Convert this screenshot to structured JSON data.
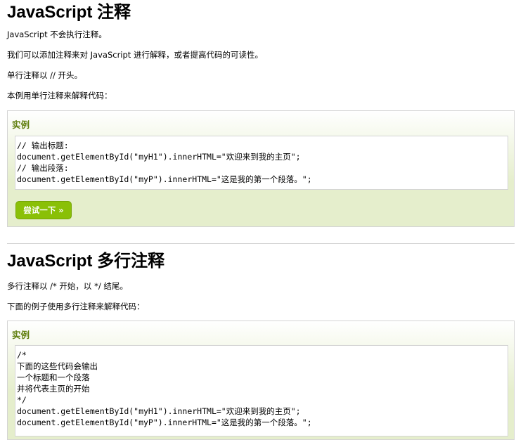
{
  "section1": {
    "heading": "JavaScript 注释",
    "paragraphs": [
      "JavaScript 不会执行注释。",
      "我们可以添加注释来对 JavaScript 进行解释，或者提高代码的可读性。",
      "单行注释以 // 开头。",
      "本例用单行注释来解释代码："
    ],
    "example": {
      "title": "实例",
      "code_lines": [
        "// 输出标题:",
        "document.getElementById(\"myH1\").innerHTML=\"欢迎来到我的主页\";",
        "// 输出段落:",
        "document.getElementById(\"myP\").innerHTML=\"这是我的第一个段落。\";"
      ],
      "button_label": "尝试一下 »"
    }
  },
  "section2": {
    "heading": "JavaScript 多行注释",
    "paragraphs": [
      "多行注释以 /* 开始，以 */ 结尾。",
      "下面的例子使用多行注释来解释代码："
    ],
    "example": {
      "title": "实例",
      "code_lines": [
        "/*",
        "下面的这些代码会输出",
        "一个标题和一个段落",
        "并将代表主页的开始",
        "*/",
        "document.getElementById(\"myH1\").innerHTML=\"欢迎来到我的主页\";",
        "document.getElementById(\"myP\").innerHTML=\"这是我的第一个段落。\";"
      ]
    }
  },
  "colors": {
    "example_bg": "#e5eecc",
    "example_title": "#617f10",
    "button_bg": "#8ac007",
    "border": "#d4d4d4"
  }
}
